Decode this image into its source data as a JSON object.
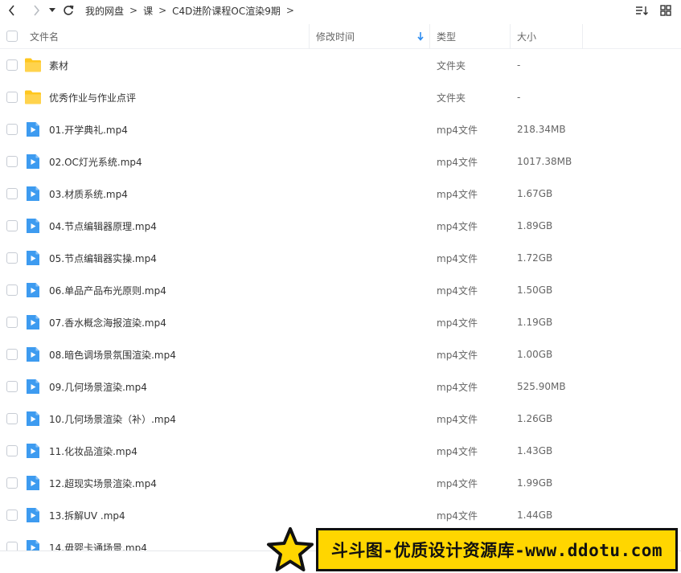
{
  "breadcrumb": [
    "我的网盘",
    "课",
    "C4D进阶课程OC渲染9期"
  ],
  "breadcrumb_sep": ">",
  "columns": {
    "name": "文件名",
    "modified": "修改时间",
    "type": "类型",
    "size": "大小"
  },
  "files": [
    {
      "name": "素材",
      "type": "文件夹",
      "size": "-",
      "kind": "folder"
    },
    {
      "name": "优秀作业与作业点评",
      "type": "文件夹",
      "size": "-",
      "kind": "folder"
    },
    {
      "name": "01.开学典礼.mp4",
      "type": "mp4文件",
      "size": "218.34MB",
      "kind": "video"
    },
    {
      "name": "02.OC灯光系统.mp4",
      "type": "mp4文件",
      "size": "1017.38MB",
      "kind": "video"
    },
    {
      "name": "03.材质系统.mp4",
      "type": "mp4文件",
      "size": "1.67GB",
      "kind": "video"
    },
    {
      "name": "04.节点编辑器原理.mp4",
      "type": "mp4文件",
      "size": "1.89GB",
      "kind": "video"
    },
    {
      "name": "05.节点编辑器实操.mp4",
      "type": "mp4文件",
      "size": "1.72GB",
      "kind": "video"
    },
    {
      "name": "06.单品产品布光原则.mp4",
      "type": "mp4文件",
      "size": "1.50GB",
      "kind": "video"
    },
    {
      "name": "07.香水概念海报渲染.mp4",
      "type": "mp4文件",
      "size": "1.19GB",
      "kind": "video"
    },
    {
      "name": "08.暗色调场景氛围渲染.mp4",
      "type": "mp4文件",
      "size": "1.00GB",
      "kind": "video"
    },
    {
      "name": "09.几何场景渲染.mp4",
      "type": "mp4文件",
      "size": "525.90MB",
      "kind": "video"
    },
    {
      "name": "10.几何场景渲染（补）.mp4",
      "type": "mp4文件",
      "size": "1.26GB",
      "kind": "video"
    },
    {
      "name": "11.化妆品渲染.mp4",
      "type": "mp4文件",
      "size": "1.43GB",
      "kind": "video"
    },
    {
      "name": "12.超现实场景渲染.mp4",
      "type": "mp4文件",
      "size": "1.99GB",
      "kind": "video"
    },
    {
      "name": "13.拆解UV .mp4",
      "type": "mp4文件",
      "size": "1.44GB",
      "kind": "video"
    },
    {
      "name": "14.毋婴卡通场景.mp4",
      "type": "",
      "size": "",
      "kind": "video"
    }
  ],
  "watermark": "斗斗图-优质设计资源库-www.ddotu.com",
  "colors": {
    "folder": "#ffc71f",
    "video": "#3d9bf0",
    "banner": "#ffd600",
    "sort_arrow": "#2d8cf0"
  }
}
